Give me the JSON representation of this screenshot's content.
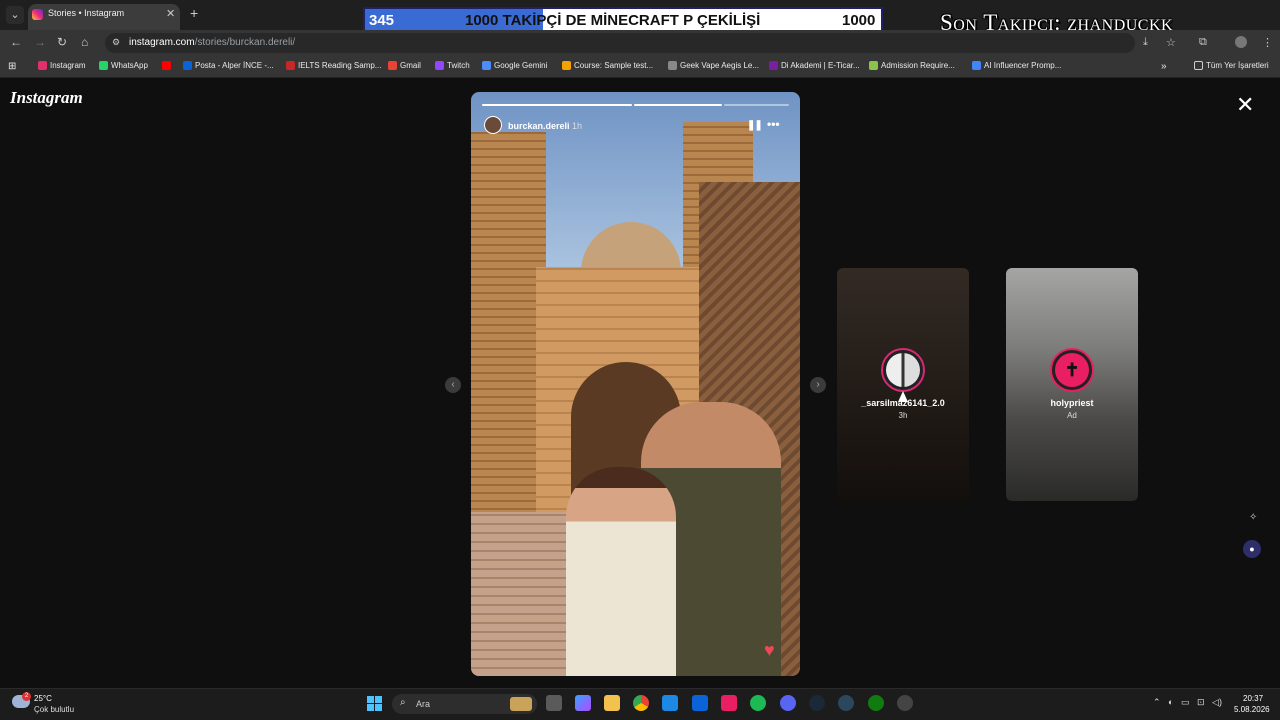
{
  "browser": {
    "tab_title": "Stories • Instagram",
    "url_host": "instagram.com",
    "url_path": "/stories/burckan.dereli/",
    "bookmarks": [
      {
        "label": "Instagram",
        "icon": "instagram-icon",
        "color": "#e1306c"
      },
      {
        "label": "WhatsApp",
        "icon": "whatsapp-icon",
        "color": "#25d366"
      },
      {
        "label": "",
        "icon": "youtube-icon",
        "color": "#ff0000"
      },
      {
        "label": "Posta - Alper İNCE -...",
        "icon": "outlook-icon",
        "color": "#0a64d8"
      },
      {
        "label": "IELTS Reading Samp...",
        "icon": "ielts-icon",
        "color": "#c62828"
      },
      {
        "label": "Gmail",
        "icon": "gmail-icon",
        "color": "#ea4335"
      },
      {
        "label": "Twitch",
        "icon": "twitch-icon",
        "color": "#9146ff"
      },
      {
        "label": "Google Gemini",
        "icon": "gemini-icon",
        "color": "#4e8cf7"
      },
      {
        "label": "Course: Sample test...",
        "icon": "course-icon",
        "color": "#f4a300"
      },
      {
        "label": "Geek Vape Aegis Le...",
        "icon": "geekvape-icon",
        "color": "#888888"
      },
      {
        "label": "Di Akademi | E-Ticar...",
        "icon": "diakademi-icon",
        "color": "#7b1fa2"
      },
      {
        "label": "Admission Require...",
        "icon": "admission-icon",
        "color": "#8bc34a"
      },
      {
        "label": "AI Influencer Promp...",
        "icon": "docs-icon",
        "color": "#4285f4"
      }
    ],
    "all_bookmarks_label": "Tüm Yer İşaretleri"
  },
  "overlay": {
    "current": "345",
    "title": "1000 TAKİPÇİ DE MİNECRAFT P ÇEKİLİŞİ",
    "goal": "1000",
    "last_follower": "Son Takipçi: zhanduckk"
  },
  "page": {
    "logo": "Instagram",
    "story": {
      "username": "burckan.dereli",
      "time": "1h"
    },
    "side_stories": [
      {
        "username": "_sarsilmaz6141_2.0",
        "time": "3h"
      },
      {
        "username": "holypriest",
        "time": "Ad"
      }
    ]
  },
  "taskbar": {
    "weather_temp": "25°C",
    "weather_desc": "Çok bulutlu",
    "weather_badge": "2",
    "search_placeholder": "Ara",
    "clock_time": "20:37",
    "clock_date": "5.08.2026"
  },
  "colors": {
    "accent": "#3a6bd4",
    "heart": "#ed4956",
    "story_ring": "#d62976"
  }
}
